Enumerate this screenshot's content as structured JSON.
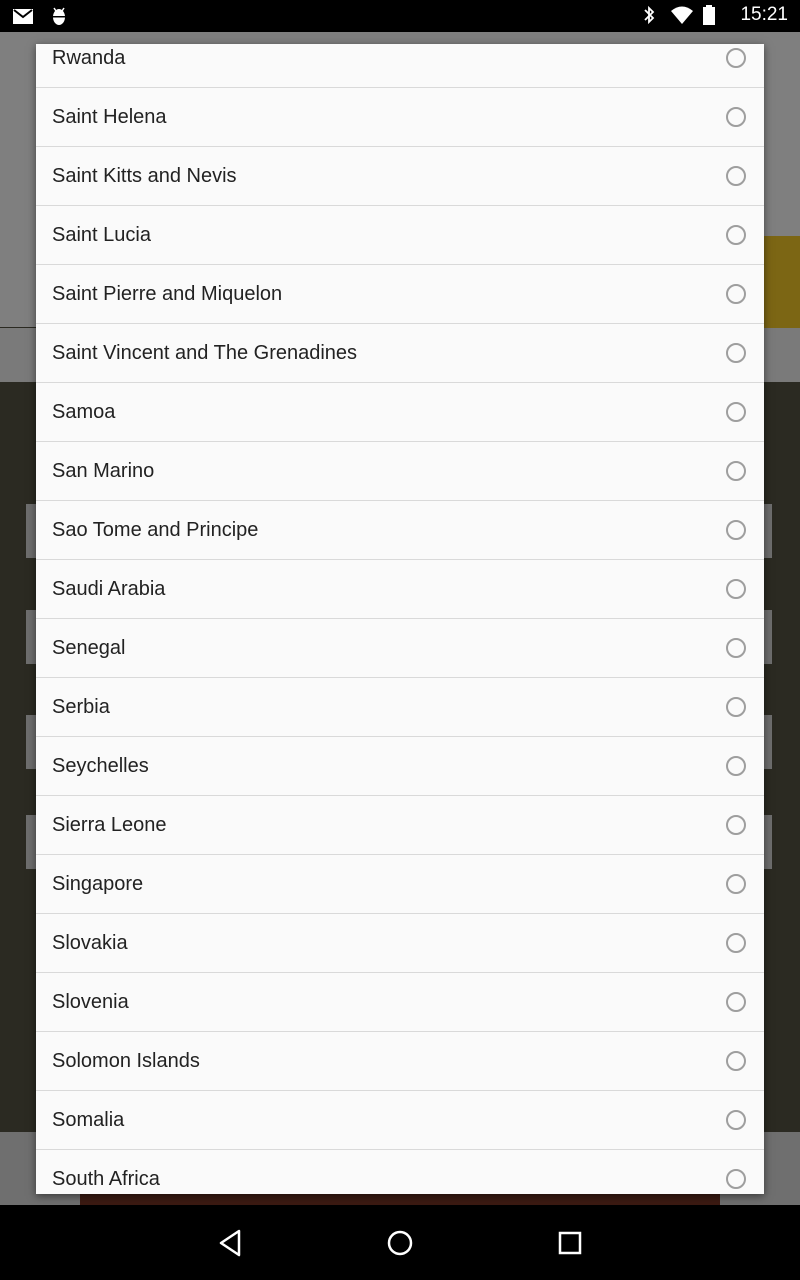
{
  "status_bar": {
    "time": "15:21",
    "icons_left": [
      "gmail-icon",
      "android-debug-icon"
    ],
    "icons_right": [
      "bluetooth-icon",
      "wifi-icon",
      "battery-icon"
    ]
  },
  "dialog": {
    "items": [
      {
        "label": "Rwanda",
        "selected": false
      },
      {
        "label": "Saint Helena",
        "selected": false
      },
      {
        "label": "Saint Kitts and Nevis",
        "selected": false
      },
      {
        "label": "Saint Lucia",
        "selected": false
      },
      {
        "label": "Saint Pierre and Miquelon",
        "selected": false
      },
      {
        "label": "Saint Vincent and The Grenadines",
        "selected": false
      },
      {
        "label": "Samoa",
        "selected": false
      },
      {
        "label": "San Marino",
        "selected": false
      },
      {
        "label": "Sao Tome and Principe",
        "selected": false
      },
      {
        "label": "Saudi Arabia",
        "selected": false
      },
      {
        "label": "Senegal",
        "selected": false
      },
      {
        "label": "Serbia",
        "selected": false
      },
      {
        "label": "Seychelles",
        "selected": false
      },
      {
        "label": "Sierra Leone",
        "selected": false
      },
      {
        "label": "Singapore",
        "selected": false
      },
      {
        "label": "Slovakia",
        "selected": false
      },
      {
        "label": "Slovenia",
        "selected": false
      },
      {
        "label": "Solomon Islands",
        "selected": false
      },
      {
        "label": "Somalia",
        "selected": false
      },
      {
        "label": "South Africa",
        "selected": false
      }
    ]
  },
  "nav_bar": {
    "buttons": [
      "back-icon",
      "home-icon",
      "recents-icon"
    ]
  },
  "colors": {
    "dialog_background": "#fafafa",
    "divider": "#d9d9d9",
    "radio_border": "#9e9e9e",
    "text": "#222222"
  }
}
